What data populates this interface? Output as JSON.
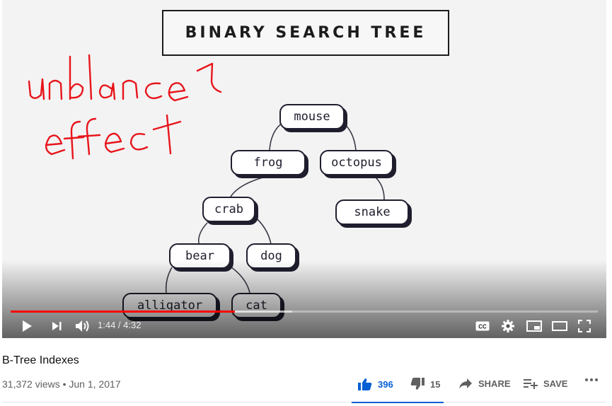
{
  "player": {
    "slide_title": "BINARY SEARCH TREE",
    "handwritten_note": [
      "unblance",
      "effect"
    ],
    "tree_nodes": {
      "mouse": "mouse",
      "frog": "frog",
      "octopus": "octopus",
      "crab": "crab",
      "snake": "snake",
      "bear": "bear",
      "dog": "dog",
      "alligator": "alligator",
      "cat": "cat"
    },
    "time_display": "1:44 / 4:32",
    "progress_fraction": 0.382,
    "colors": {
      "progress": "#ff0000",
      "annotation": "#e8141b"
    }
  },
  "video": {
    "title": "B-Tree Indexes",
    "meta": "31,372 views • Jun 1, 2017",
    "likes": "396",
    "dislikes": "15",
    "share_label": "SHARE",
    "save_label": "SAVE"
  },
  "icons": {
    "play": "play-icon",
    "next": "next-icon",
    "volume": "volume-icon",
    "cc": "captions-icon",
    "settings": "gear-icon",
    "miniplayer": "miniplayer-icon",
    "theater": "theater-icon",
    "fullscreen": "fullscreen-icon",
    "like": "thumbs-up-icon",
    "dislike": "thumbs-down-icon",
    "share": "share-icon",
    "save": "playlist-add-icon",
    "more": "more-icon"
  },
  "colors": {
    "accent": "#065fd4"
  }
}
